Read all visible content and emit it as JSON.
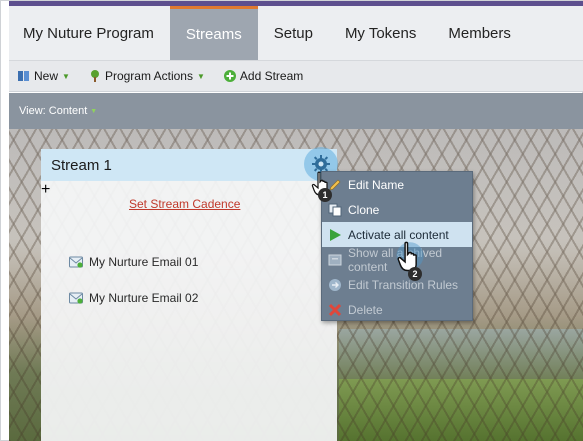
{
  "tabs": [
    {
      "label": "My Nuture Program",
      "active": false
    },
    {
      "label": "Streams",
      "active": true
    },
    {
      "label": "Setup",
      "active": false
    },
    {
      "label": "My Tokens",
      "active": false
    },
    {
      "label": "Members",
      "active": false
    }
  ],
  "toolbar": {
    "new_label": "New",
    "program_actions_label": "Program Actions",
    "add_stream_label": "Add Stream"
  },
  "view": {
    "label": "View: Content"
  },
  "stream": {
    "title": "Stream 1",
    "cadence_link": "Set Stream Cadence",
    "emails": [
      "My Nurture Email 01",
      "My Nurture Email 02"
    ]
  },
  "context_menu": {
    "items": [
      {
        "label": "Edit Name",
        "icon": "pencil-icon",
        "state": "normal"
      },
      {
        "label": "Clone",
        "icon": "clone-icon",
        "state": "normal"
      },
      {
        "label": "Activate all content",
        "icon": "play-icon",
        "state": "active"
      },
      {
        "label": "Show all archived content",
        "icon": "archive-icon",
        "state": "disabled"
      },
      {
        "label": "Edit Transition Rules",
        "icon": "transition-icon",
        "state": "disabled"
      },
      {
        "label": "Delete",
        "icon": "delete-icon",
        "state": "disabled"
      }
    ]
  },
  "annotations": {
    "step1": "1",
    "step2": "2"
  },
  "colors": {
    "accent_orange": "#e07a2f",
    "active_tab": "#9ea6b0",
    "link_red": "#c0392b",
    "menu_bg": "#6d7e90",
    "panel_header": "#cfe7f5",
    "brand_purple": "#5d4f8e"
  }
}
